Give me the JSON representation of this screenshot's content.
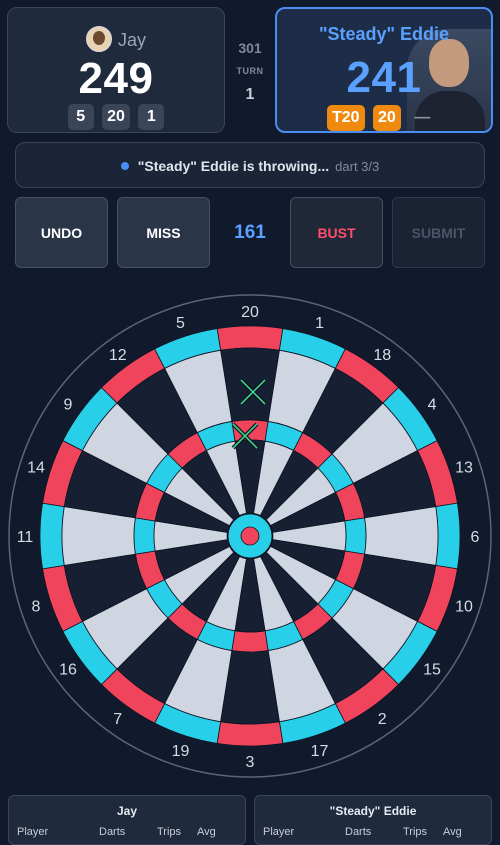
{
  "player1": {
    "name": "Jay",
    "score": "249",
    "darts": [
      "5",
      "20",
      "1"
    ]
  },
  "player2": {
    "name": "\"Steady\" Eddie",
    "score": "241",
    "darts": [
      "T20",
      "20",
      "—"
    ]
  },
  "game": {
    "mode": "301",
    "turn_label": "TURN",
    "turn": "1"
  },
  "status": {
    "text": "\"Steady\" Eddie is throwing...",
    "dart_progress": "dart 3/3"
  },
  "buttons": {
    "undo": "UNDO",
    "miss": "MISS",
    "remaining": "161",
    "bust": "BUST",
    "submit": "SUBMIT"
  },
  "board": {
    "numbers": [
      "20",
      "1",
      "18",
      "4",
      "13",
      "6",
      "10",
      "15",
      "2",
      "17",
      "3",
      "19",
      "7",
      "16",
      "8",
      "11",
      "14",
      "9",
      "12",
      "5"
    ],
    "colors": {
      "red": "#f0445c",
      "cyan": "#27cfe8",
      "light": "#cfd6e2",
      "dark": "#172033",
      "ring": "#5a6578"
    }
  },
  "tables": {
    "left": {
      "title": "Jay",
      "headers": [
        "Player",
        "Darts",
        "Trips",
        "Avg"
      ]
    },
    "right": {
      "title": "\"Steady\" Eddie",
      "headers": [
        "Player",
        "Darts",
        "Trips",
        "Avg"
      ]
    }
  }
}
